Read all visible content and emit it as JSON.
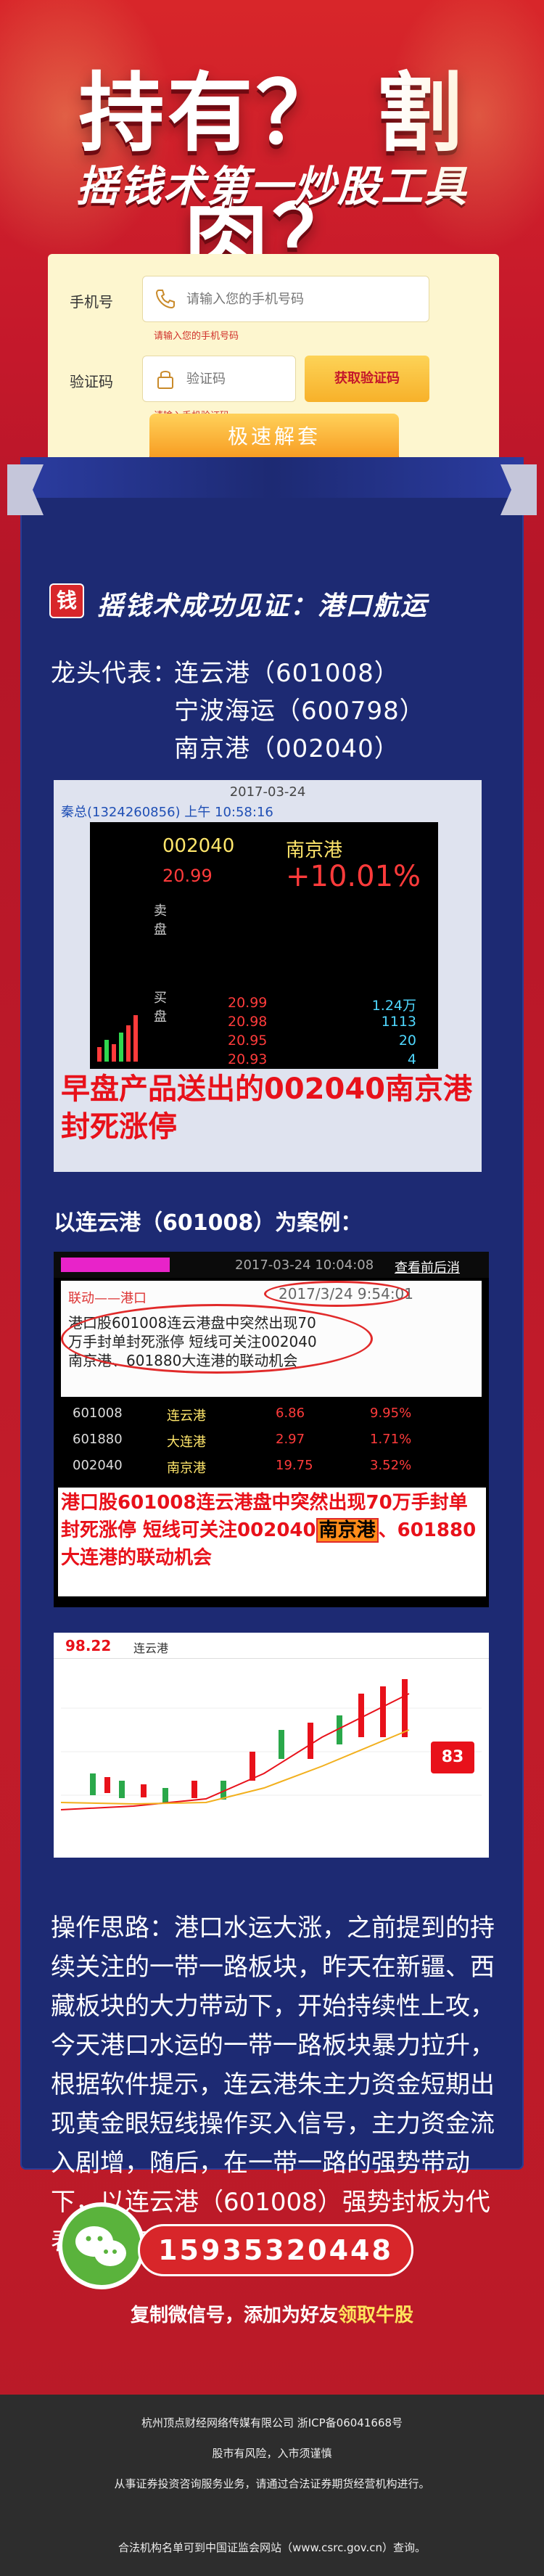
{
  "hero": {
    "headline": "持有？ 割肉？",
    "subheadline": "摇钱术第一炒股工具"
  },
  "form": {
    "phone_label": "手机号",
    "phone_placeholder": "请输入您的手机号码",
    "phone_hint": "请输入您的手机号码",
    "code_label": "验证码",
    "code_placeholder": "验证码",
    "code_hint": "请输入手机验证码",
    "get_code_button": "获取验证码",
    "submit_button": "极速解套"
  },
  "section": {
    "logo_text": "钱",
    "title": "摇钱术成功见证：港口航运",
    "rep_prefix": "龙头代表：",
    "reps": [
      "连云港（601008）",
      "宁波海运（600798）",
      "南京港（002040）"
    ]
  },
  "screenshot1": {
    "date": "2017-03-24",
    "user_line": "秦总(1324260856) 上午 10:58:16",
    "code": "002040",
    "name": "南京港",
    "price": "20.99",
    "change_pct": "+10.01%",
    "sell_label": "卖盘",
    "buy_label": "买盘",
    "order_rows": [
      {
        "price": "20.99",
        "volume": "1.24万"
      },
      {
        "price": "20.98",
        "volume": "1113"
      },
      {
        "price": "20.95",
        "volume": "20"
      },
      {
        "price": "20.93",
        "volume": "4"
      }
    ],
    "caption": "早盘产品送出的002040南京港 封死涨停"
  },
  "case_title": "以连云港（601008）为案例：",
  "screenshot2": {
    "date": "2017-03-24 10:04:08",
    "link": "查看前后消",
    "linkage_head": "联动——港口",
    "stamp": "2017/3/24 9:54:01",
    "lines": [
      "港口股601008连云港盘中突然出现70",
      "万手封单封死涨停 短线可关注002040",
      "南京港、601880大连港的联动机会"
    ],
    "table": [
      {
        "code": "601008",
        "name": "连云港",
        "price": "6.86",
        "pct": "9.95%"
      },
      {
        "code": "601880",
        "name": "大连港",
        "price": "2.97",
        "pct": "1.71%"
      },
      {
        "code": "002040",
        "name": "南京港",
        "price": "19.75",
        "pct": "3.52%"
      }
    ],
    "caption_1": "港口股601008连云港盘中突然出现70万手封单封死涨停 短线可关注002040",
    "caption_hl": "南京港",
    "caption_2": "、601880大连港的联动机会"
  },
  "screenshot3": {
    "score": "98.22",
    "name": "连云港",
    "pct_badge": "83"
  },
  "ops_text": "操作思路：港口水运大涨，之前提到的持续关注的一带一路板块，昨天在新疆、西藏板块的大力带动下，开始持续性上攻，今天港口水运的一带一路板块暴力拉升，根据软件提示，连云港朱主力资金短期出现黄金眼短线操作买入信号，主力资金流入剧增，随后，在一带一路的强势带动下，以连云港（601008）强势封板为代表的港口航运出现大幅度上涨！",
  "contact": {
    "phone": "15935320448",
    "note_prefix": "复制微信号，添加为好友",
    "note_highlight": "领取牛股"
  },
  "footer": {
    "line1": "杭州顶点财经网络传媒有限公司 浙ICP备06041668号",
    "line2": "股市有风险，入市须谨慎",
    "line3": "从事证券投资咨询服务业务，请通过合法证券期货经营机构进行。",
    "line4": "合法机构名单可到中国证监会网站（www.csrc.gov.cn）查询。"
  },
  "colors": {
    "brand_red": "#d8262a",
    "panel_blue": "#1d2a73",
    "accent_yellow": "#ffe45c"
  }
}
